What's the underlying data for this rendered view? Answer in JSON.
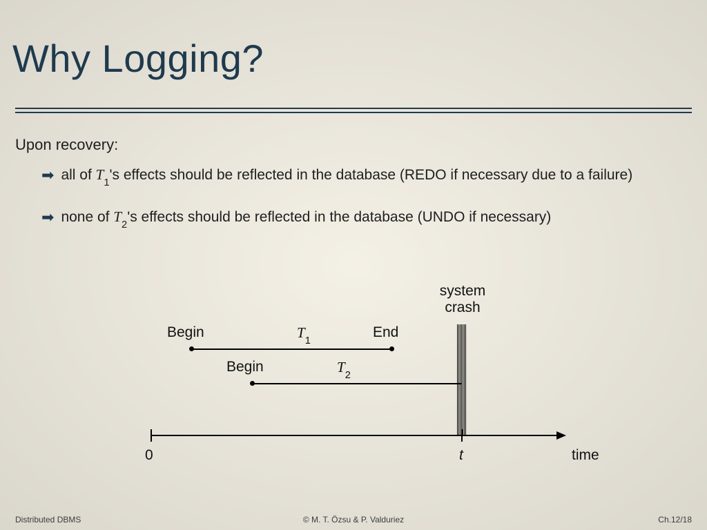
{
  "title": "Why Logging?",
  "lead": "Upon recovery:",
  "bullets": [
    {
      "pre": "all of ",
      "txn": "T",
      "sub": "1",
      "post": "'s effects should be reflected in the database (REDO if necessary due to a failure)"
    },
    {
      "pre": "none of ",
      "txn": "T",
      "sub": "2",
      "post": "'s effects should be reflected in the database (UNDO if necessary)"
    }
  ],
  "diagram": {
    "t1": {
      "begin": "Begin",
      "label_txn": "T",
      "label_sub": "1",
      "end": "End"
    },
    "t2": {
      "begin": "Begin",
      "label_txn": "T",
      "label_sub": "2"
    },
    "crash_label_1": "system",
    "crash_label_2": "crash",
    "axis_zero": "0",
    "axis_t": "t",
    "axis_time": "time"
  },
  "footer": {
    "left": "Distributed DBMS",
    "center": "© M. T. Özsu & P. Valduriez",
    "right": "Ch.12/18"
  },
  "chart_data": {
    "type": "table",
    "title": "Transaction timeline relative to system crash",
    "crash_time_label": "t",
    "axis_start_label": "0",
    "axis_label": "time",
    "crash_position_fraction": 0.74,
    "transactions": [
      {
        "name": "T1",
        "begin_fraction": 0.15,
        "end_fraction": 0.58,
        "committed_before_crash": true,
        "action_on_recovery": "REDO"
      },
      {
        "name": "T2",
        "begin_fraction": 0.32,
        "end_fraction": 0.74,
        "committed_before_crash": false,
        "action_on_recovery": "UNDO"
      }
    ]
  }
}
